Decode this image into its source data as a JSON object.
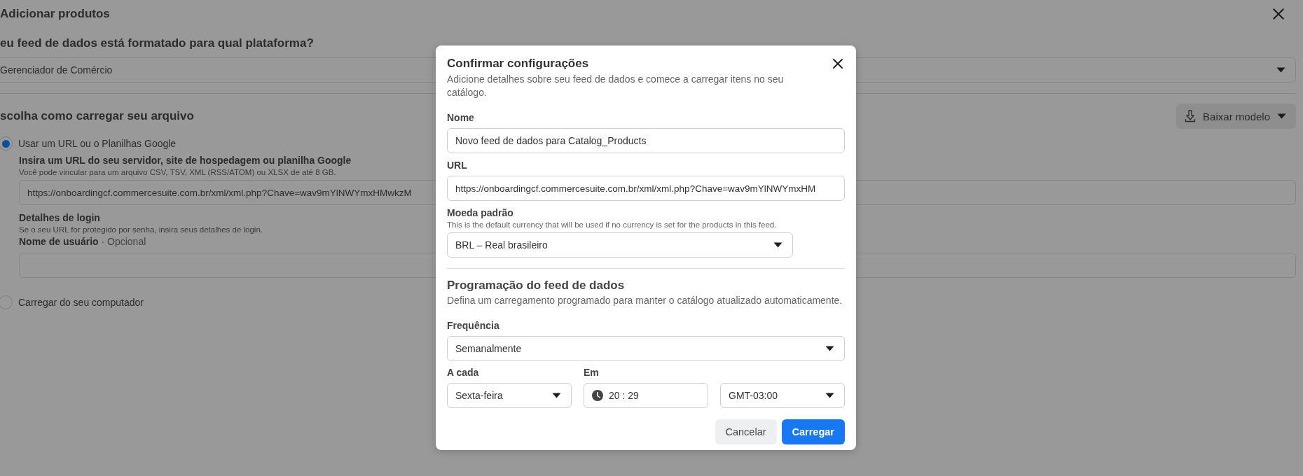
{
  "page": {
    "title": "Adicionar produtos",
    "platform_question": "eu feed de dados está formatado para qual plataforma?",
    "platform_select": {
      "value": "Gerenciador de Comércio"
    },
    "upload_heading": "scolha como carregar seu arquivo",
    "download_button": "Baixar modelo",
    "upload_options": [
      {
        "label": "Usar um URL ou o Planilhas Google",
        "selected": true
      },
      {
        "label": "Carregar do seu computador",
        "selected": false
      }
    ],
    "url_section": {
      "label": "Insira um URL do seu servidor, site de hospedagem ou planilha Google",
      "hint": "Você pode vincular para um arquivo CSV, TSV, XML (RSS/ATOM) ou XLSX de até 8 GB.",
      "value": "https://onboardingcf.commercesuite.com.br/xml/xml.php?Chave=wav9mYlNWYmxHMwkzM"
    },
    "login": {
      "heading": "Detalhes de login",
      "hint": "Se o seu URL for protegido por senha, insira seus detalhes de login.",
      "username_label": "Nome de usuário",
      "username_optional": "· Opcional"
    }
  },
  "modal": {
    "title": "Confirmar configurações",
    "subtitle": "Adicione detalhes sobre seu feed de dados e comece a carregar itens no seu catálogo.",
    "fields": [
      {
        "kind": "text",
        "label": "Nome",
        "value": "Novo feed de dados para Catalog_Products"
      },
      {
        "kind": "text",
        "label": "URL",
        "value": "https://onboardingcf.commercesuite.com.br/xml/xml.php?Chave=wav9mYlNWYmxHM"
      },
      {
        "kind": "select",
        "label": "Moeda padrão",
        "hint": "This is the default currency that will be used if no currency is set for the products in this feed.",
        "value": "BRL – Real brasileiro"
      }
    ],
    "schedule": {
      "title": "Programação do feed de dados",
      "subtitle": "Defina um carregamento programado para manter o catálogo atualizado automaticamente.",
      "frequency": {
        "label": "Frequência",
        "value": "Semanalmente"
      },
      "day": {
        "label": "A cada",
        "value": "Sexta-feira"
      },
      "time": {
        "label": "Em",
        "hours": "20",
        "separator": ":",
        "minutes": "29"
      },
      "timezone": {
        "value": "GMT-03:00"
      }
    },
    "buttons": [
      {
        "label": "Cancelar",
        "kind": "secondary"
      },
      {
        "label": "Carregar",
        "kind": "primary"
      }
    ]
  }
}
